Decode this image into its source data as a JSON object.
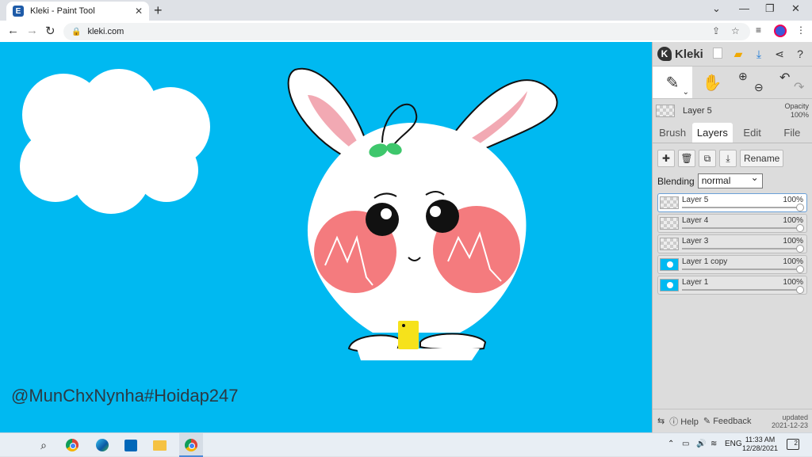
{
  "browser": {
    "tab_title": "Kleki - Paint Tool",
    "favicon_letter": "E",
    "url": "kleki.com"
  },
  "canvas": {
    "background_color": "#00b9f1",
    "watermark": "@MunChxNynha#Hoidap247"
  },
  "app": {
    "brand": "Kleki",
    "current_layer": "Layer 5",
    "opacity_label": "Opacity",
    "opacity_value": "100%",
    "tabs": [
      "Brush",
      "Layers",
      "Edit",
      "File"
    ],
    "active_tab": "Layers",
    "rename_label": "Rename",
    "blending_label": "Blending",
    "blending_value": "normal",
    "layers": [
      {
        "name": "Layer 5",
        "opacity": "100%",
        "thumb": "transparent",
        "active": true
      },
      {
        "name": "Layer 4",
        "opacity": "100%",
        "thumb": "transparent",
        "active": false
      },
      {
        "name": "Layer 3",
        "opacity": "100%",
        "thumb": "transparent",
        "active": false
      },
      {
        "name": "Layer 1 copy",
        "opacity": "100%",
        "thumb": "blue",
        "active": false
      },
      {
        "name": "Layer 1",
        "opacity": "100%",
        "thumb": "blue",
        "active": false
      }
    ],
    "footer": {
      "help": "Help",
      "feedback": "Feedback",
      "updated_label": "updated",
      "updated_date": "2021-12-23"
    }
  },
  "taskbar": {
    "lang": "ENG",
    "time": "11:33 AM",
    "date": "12/28/2021",
    "notifications": "2"
  }
}
